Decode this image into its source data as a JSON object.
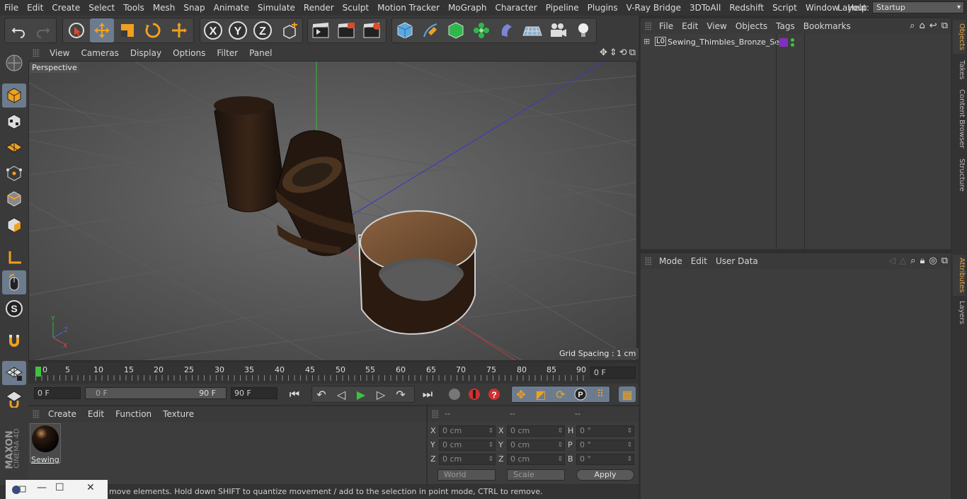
{
  "menubar": {
    "items": [
      "File",
      "Edit",
      "Create",
      "Select",
      "Tools",
      "Mesh",
      "Snap",
      "Animate",
      "Simulate",
      "Render",
      "Sculpt",
      "Motion Tracker",
      "MoGraph",
      "Character",
      "Pipeline",
      "Plugins",
      "V-Ray Bridge",
      "3DToAll",
      "Redshift",
      "Script",
      "Window",
      "Help"
    ],
    "layout_label": "Layout:",
    "layout_value": "Startup"
  },
  "viewport": {
    "menu": [
      "View",
      "Cameras",
      "Display",
      "Options",
      "Filter",
      "Panel"
    ],
    "label": "Perspective",
    "grid_spacing": "Grid Spacing : 1 cm"
  },
  "timeline": {
    "ticks": [
      "0",
      "5",
      "10",
      "15",
      "20",
      "25",
      "30",
      "35",
      "40",
      "45",
      "50",
      "55",
      "60",
      "65",
      "70",
      "75",
      "80",
      "85",
      "90"
    ],
    "current_frame": "0 F",
    "start_field": "0 F",
    "range_start": "0 F",
    "range_end": "90 F",
    "end_field": "90 F"
  },
  "material_panel": {
    "menu": [
      "Create",
      "Edit",
      "Function",
      "Texture"
    ],
    "material_name": "Sewing"
  },
  "coords": {
    "headers": [
      "--",
      "--",
      "--"
    ],
    "rows": [
      {
        "l1": "X",
        "v1": "0 cm",
        "l2": "X",
        "v2": "0 cm",
        "l3": "H",
        "v3": "0 °"
      },
      {
        "l1": "Y",
        "v1": "0 cm",
        "l2": "Y",
        "v2": "0 cm",
        "l3": "P",
        "v3": "0 °"
      },
      {
        "l1": "Z",
        "v1": "0 cm",
        "l2": "Z",
        "v2": "0 cm",
        "l3": "B",
        "v3": "0 °"
      }
    ],
    "mode_world": "World",
    "mode_scale": "Scale",
    "apply": "Apply"
  },
  "object_manager": {
    "menu": [
      "File",
      "Edit",
      "View",
      "Objects",
      "Tags",
      "Bookmarks"
    ],
    "object_name": "Sewing_Thimbles_Bronze_Set",
    "layer_badge": "L0"
  },
  "attributes": {
    "menu": [
      "Mode",
      "Edit",
      "User Data"
    ]
  },
  "right_tabs": [
    "Objects",
    "Takes",
    "Content Browser",
    "Structure",
    "Attributes",
    "Layers"
  ],
  "status": {
    "text": "move elements. Hold down SHIFT to quantize movement / add to the selection in point mode, CTRL to remove."
  },
  "brand": {
    "line1": "MAXON",
    "line2": "CINEMA 4D"
  },
  "colors": {
    "accent": "#e0a54a",
    "active_tool": "#6c7c8e",
    "play_green": "#3ec33e"
  }
}
